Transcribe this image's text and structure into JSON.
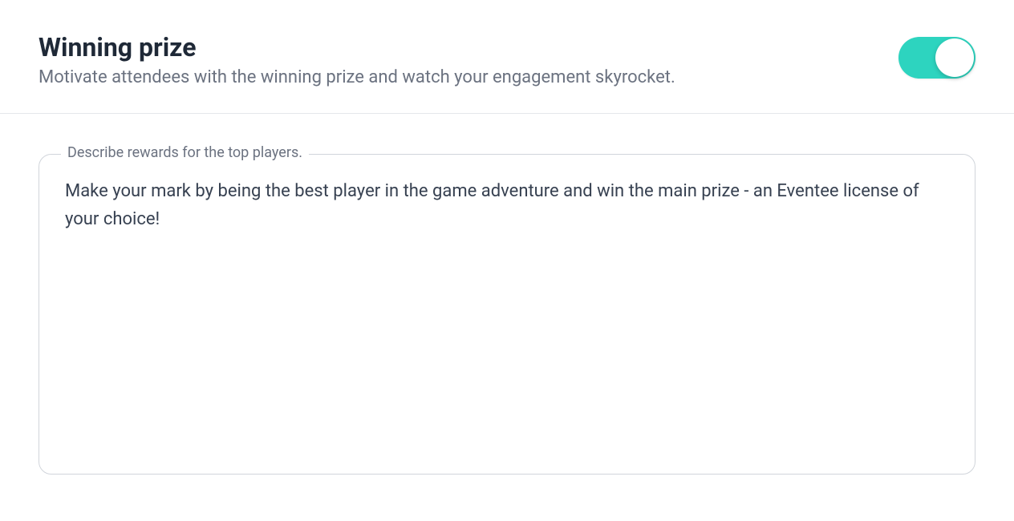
{
  "header": {
    "title": "Winning prize",
    "subtitle": "Motivate attendees with the winning prize and watch your engagement skyrocket.",
    "toggle_on": true
  },
  "form": {
    "rewards_label": "Describe rewards for the top players.",
    "rewards_value": "Make your mark by being the best player in the game adventure and win the main prize - an Eventee license of your choice!"
  }
}
